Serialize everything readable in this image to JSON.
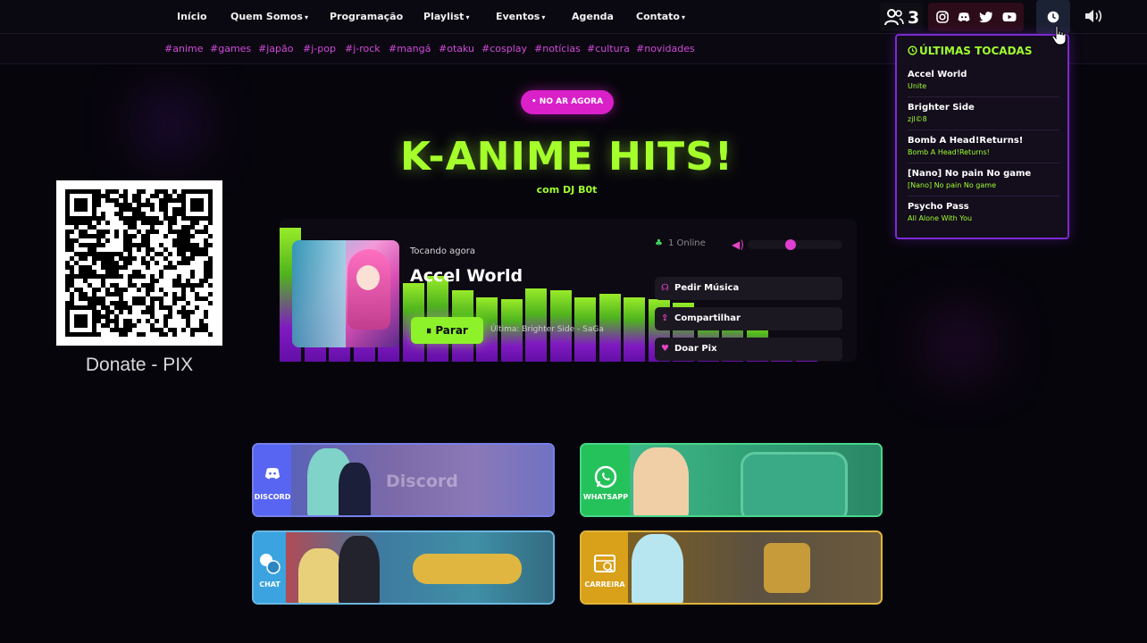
{
  "nav": {
    "items": [
      "Início",
      "Quem Somos",
      "Programação",
      "Playlist",
      "Eventos",
      "Agenda",
      "Contato"
    ],
    "dropdown_caret": "▾"
  },
  "tags": [
    "#anime",
    "#games",
    "#japão",
    "#j-pop",
    "#j-rock",
    "#mangá",
    "#otaku",
    "#cosplay",
    "#notícias",
    "#cultura",
    "#novidades"
  ],
  "listeners": {
    "count": "3"
  },
  "history": {
    "title": "ÚLTIMAS TOCADAS",
    "items": [
      {
        "title": "Accel World",
        "artist": "Unite"
      },
      {
        "title": "Brighter Side",
        "artist": "zjl©8"
      },
      {
        "title": "Bomb A Head!Returns!",
        "artist": "Bomb A Head!Returns!"
      },
      {
        "title": "[Nano] No pain No game",
        "artist": "[Nano] No pain No game"
      },
      {
        "title": "Psycho Pass",
        "artist": "All Alone With You"
      }
    ]
  },
  "hero": {
    "live_label": "• NO AR AGORA",
    "title": "K-ANIME HITS!",
    "subtitle": "com DJ B0t"
  },
  "donate": {
    "caption": "Donate - PIX"
  },
  "player": {
    "now_label": "Tocando agora",
    "track_title": "Accel World",
    "stop_label": "⏸ Parar",
    "last_label": "Última: Brighter Side - SaGa",
    "online_label": "1 Online",
    "volume": 0.45,
    "actions": [
      "Pedir Música",
      "Compartilhar",
      "Doar Pix"
    ]
  },
  "cards": [
    {
      "label": "DISCORD",
      "word": "Discord",
      "color": "#5865f2"
    },
    {
      "label": "WHATSAPP",
      "word": "",
      "color": "#25c25c"
    },
    {
      "label": "CHAT",
      "word": "",
      "color": "#3aa3e0"
    },
    {
      "label": "CARREIRA",
      "word": "",
      "color": "#d9a019"
    }
  ],
  "colors": {
    "accent_green": "#a4ff2b",
    "accent_pink": "#d920c9",
    "accent_purple": "#7b2ad1"
  }
}
